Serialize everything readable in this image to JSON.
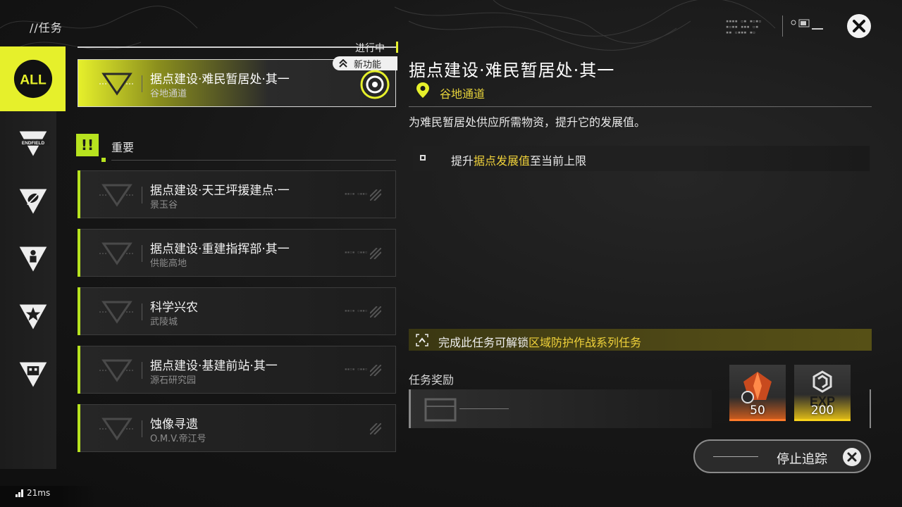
{
  "header": {
    "title": "//任务"
  },
  "rail": {
    "items": [
      {
        "label": "ALL",
        "icon": "all-icon",
        "active": true
      },
      {
        "label": "ENDFIELD",
        "icon": "endfield-icon"
      },
      {
        "label": "",
        "icon": "leaf-icon"
      },
      {
        "label": "",
        "icon": "person-icon"
      },
      {
        "label": "",
        "icon": "star-icon"
      },
      {
        "label": "",
        "icon": "building-icon"
      }
    ]
  },
  "status": {
    "ping": "21ms"
  },
  "quest_list": {
    "in_progress_label": "进行中",
    "active": {
      "title": "据点建设·难民暂居处·其一",
      "location": "谷地通道",
      "badge": "新功能"
    },
    "section": {
      "badge": "!!",
      "label": "重要"
    },
    "items": [
      {
        "title": "据点建设·天王坪援建点·一",
        "location": "景玉谷"
      },
      {
        "title": "据点建设·重建指挥部·其一",
        "location": "供能高地"
      },
      {
        "title": "科学兴农",
        "location": "武陵城"
      },
      {
        "title": "据点建设·基建前站·其一",
        "location": "源石研究园"
      },
      {
        "title": "蚀像寻遗",
        "location": "O.M.V.帝江号"
      }
    ]
  },
  "detail": {
    "title": "据点建设·难民暂居处·其一",
    "location": "谷地通道",
    "description": "为难民暂居处供应所需物资，提升它的发展值。",
    "objective": {
      "prefix": "提升",
      "highlight": "据点发展值",
      "suffix": "至当前上限"
    },
    "unlock": {
      "prefix": "完成此任务可解锁",
      "highlight": "区域防护作战系列任务"
    },
    "reward_label": "任务奖励",
    "rewards": [
      {
        "name": "crystal-reward",
        "qty": "50",
        "color": "#ff7a2a"
      },
      {
        "name": "exp-reward",
        "label": "EXP",
        "qty": "200",
        "color": "#f7d21c"
      }
    ],
    "stop_tracking": "停止追踪"
  },
  "colors": {
    "accent": "#e6f02b",
    "lime": "#b7e31f",
    "highlight": "#f0d23a"
  }
}
